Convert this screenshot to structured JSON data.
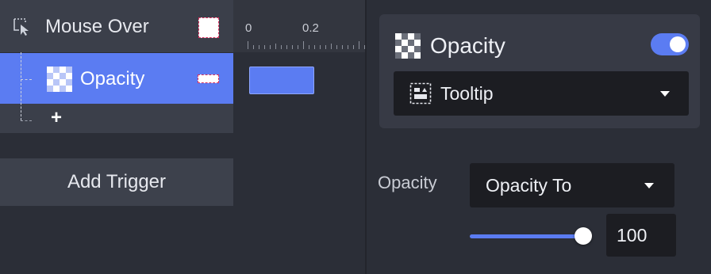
{
  "triggers": {
    "trigger_label": "Mouse Over",
    "action_label": "Opacity",
    "add_action_symbol": "+",
    "add_trigger_label": "Add Trigger"
  },
  "timeline": {
    "tick_labels": [
      "0",
      "0.2"
    ]
  },
  "properties": {
    "action_title": "Opacity",
    "action_enabled": true,
    "target_element": "Tooltip",
    "property_label": "Opacity",
    "mode": "Opacity To",
    "value": "100",
    "slider_level_percent": 100
  },
  "colors": {
    "accent": "#5b7cf2",
    "swatch_border": "#d8325f",
    "panel_bg": "#2b2e37",
    "card_bg": "#373a45",
    "input_bg": "#1c1d22"
  },
  "icons": {
    "trigger": "cursor-select-icon",
    "action": "opacity-checker-icon",
    "target": "tooltip-icon",
    "dropdown": "caret-down-icon"
  }
}
